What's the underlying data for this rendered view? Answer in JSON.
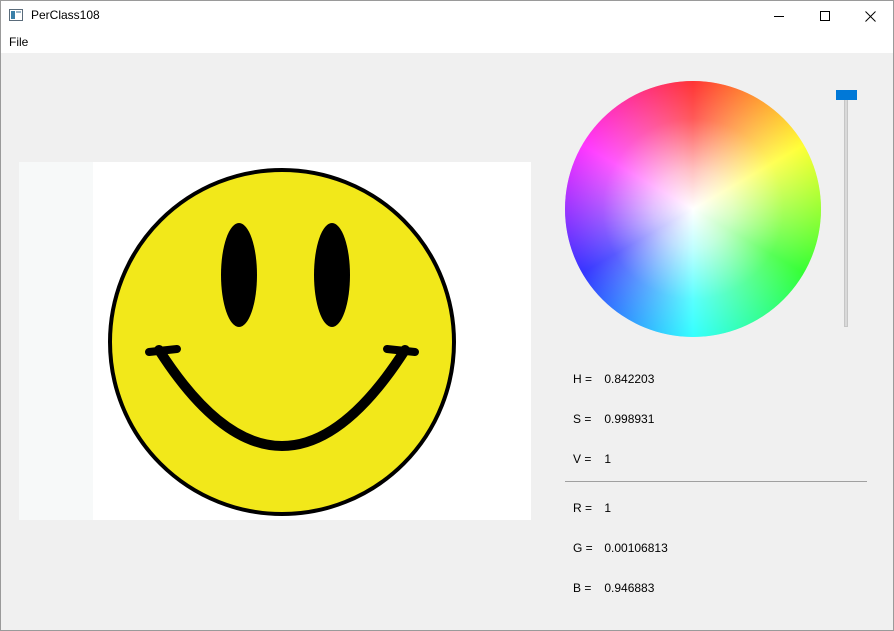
{
  "window": {
    "title": "PerClass108",
    "controls": {
      "minimize": "minimize",
      "maximize": "maximize",
      "close": "close"
    }
  },
  "menu": {
    "items": [
      {
        "label": "File"
      }
    ]
  },
  "color_wheel": {
    "icon": "color-wheel",
    "value_slider_position": 1
  },
  "hsv": {
    "h": {
      "label": "H =",
      "value": "0.842203"
    },
    "s": {
      "label": "S =",
      "value": "0.998931"
    },
    "v": {
      "label": "V =",
      "value": "1"
    }
  },
  "rgb": {
    "r": {
      "label": "R =",
      "value": "1"
    },
    "g": {
      "label": "G =",
      "value": "0.00106813"
    },
    "b": {
      "label": "B =",
      "value": "0.946883"
    }
  },
  "image": {
    "description_icon": "smiley-face-icon",
    "colors": {
      "face": "#f2e81a",
      "outline": "#000000"
    }
  }
}
